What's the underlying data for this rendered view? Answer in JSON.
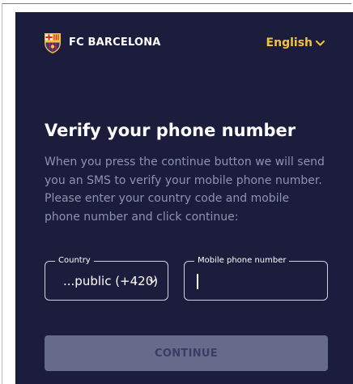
{
  "header": {
    "brand": "FC BARCELONA",
    "crest_icon": "fc-barcelona-crest-icon",
    "language": "English",
    "language_caret_icon": "chevron-down-icon"
  },
  "main": {
    "title": "Verify your phone number",
    "description": "When you press the continue button we will send you an SMS to verify your mobile phone number. Please enter your country code and mobile phone number and click continue:"
  },
  "form": {
    "country_label": "Country",
    "country_value": "...public (+420)",
    "phone_label": "Mobile phone number",
    "phone_value": "",
    "continue_label": "CONTINUE"
  },
  "colors": {
    "background": "#1c1d3d",
    "accent": "#f5c33b",
    "button_disabled": "#686a8c",
    "muted_text": "#8f92ad"
  }
}
